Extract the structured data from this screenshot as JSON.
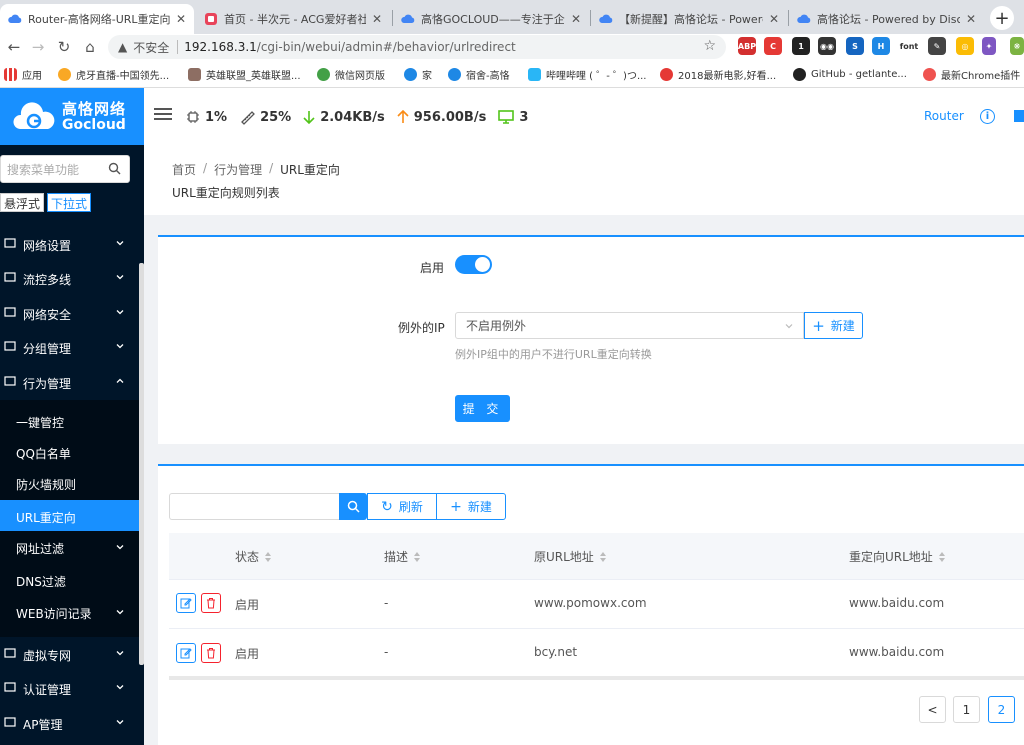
{
  "browser": {
    "tabs": [
      {
        "label": "Router-高恪网络-URL重定向",
        "icon_color": "#4285f4",
        "active": true
      },
      {
        "label": "首页 - 半次元 - ACG爱好者社区",
        "icon_color": "#e8445a",
        "active": false
      },
      {
        "label": "高恪GOCLOUD——专注于企业",
        "icon_color": "#4285f4",
        "active": false
      },
      {
        "label": "【新提醒】高恪论坛 - Powere",
        "icon_color": "#4285f4",
        "active": false
      },
      {
        "label": "高恪论坛 - Powered by Discu",
        "icon_color": "#4285f4",
        "active": false
      }
    ],
    "address": {
      "insecure_label": "不安全",
      "host": "192.168.3.1",
      "path": "/cgi-bin/webui/admin#/behavior/urlredirect"
    },
    "extensions": [
      {
        "name": "abp-icon",
        "label": "ABP",
        "color": "#d32f2f"
      },
      {
        "name": "extension-red-icon",
        "label": "C",
        "color": "#e53935"
      },
      {
        "name": "extension-badge-icon",
        "label": "1",
        "color": "#222222"
      },
      {
        "name": "extension-mask-icon",
        "label": "◉◉",
        "color": "#333333"
      },
      {
        "name": "extension-s-icon",
        "label": "S",
        "color": "#1565c0"
      },
      {
        "name": "extension-h-icon",
        "label": "H",
        "color": "#1e88e5"
      },
      {
        "name": "extension-font-icon",
        "label": "font",
        "color": "#ffffff"
      },
      {
        "name": "extension-gesture-icon",
        "label": "✎",
        "color": "#444444"
      },
      {
        "name": "chrome-icon",
        "label": "◎",
        "color": "#fbbc05"
      },
      {
        "name": "extension-purple-icon",
        "label": "✦",
        "color": "#7e57c2"
      },
      {
        "name": "extension-frog-icon",
        "label": "❋",
        "color": "#7cb342"
      }
    ],
    "bookmarks": [
      {
        "label": "应用",
        "color": "#e53935"
      },
      {
        "label": "虎牙直播-中国领先...",
        "color": "#f9a825"
      },
      {
        "label": "英雄联盟_英雄联盟...",
        "color": "#8d6e63"
      },
      {
        "label": "微信网页版",
        "color": "#43a047"
      },
      {
        "label": "家",
        "color": "#1e88e5"
      },
      {
        "label": "宿舍-高恪",
        "color": "#1e88e5"
      },
      {
        "label": "哔哩哔哩 ( ゜- ゜)つ...",
        "color": "#29b6f6"
      },
      {
        "label": "2018最新电影,好看...",
        "color": "#e53935"
      },
      {
        "label": "GitHub - getlante...",
        "color": "#212121"
      },
      {
        "label": "最新Chrome插件",
        "color": "#ef5350"
      }
    ]
  },
  "header": {
    "logo_cn": "高恪网络",
    "logo_en": "Gocloud",
    "cpu": "1%",
    "memory": "25%",
    "download": "2.04KB/s",
    "upload": "956.00B/s",
    "devices": "3",
    "router_label": "Router",
    "colors": {
      "download": "#52c41a",
      "upload": "#fa8c16",
      "devices": "#52c41a"
    }
  },
  "sidebar": {
    "search_placeholder": "搜索菜单功能",
    "mode_float": "悬浮式",
    "mode_dropdown": "下拉式",
    "menu": [
      {
        "label": "网络设置",
        "icon": "monitor-icon"
      },
      {
        "label": "流控多线",
        "icon": "flow-icon"
      },
      {
        "label": "网络安全",
        "icon": "shield-icon"
      },
      {
        "label": "分组管理",
        "icon": "group-icon"
      },
      {
        "label": "行为管理",
        "icon": "funnel-icon",
        "expanded": true
      }
    ],
    "submenu": [
      {
        "label": "一键管控"
      },
      {
        "label": "QQ白名单"
      },
      {
        "label": "防火墙规则"
      },
      {
        "label": "URL重定向",
        "active": true
      },
      {
        "label": "网址过滤",
        "has_children": true
      },
      {
        "label": "DNS过滤"
      },
      {
        "label": "WEB访问记录",
        "has_children": true
      }
    ],
    "menu_after": [
      {
        "label": "虚拟专网",
        "icon": "vpn-icon"
      },
      {
        "label": "认证管理",
        "icon": "auth-shield-icon"
      },
      {
        "label": "AP管理",
        "icon": "ap-icon"
      }
    ]
  },
  "breadcrumb": [
    "首页",
    "行为管理",
    "URL重定向"
  ],
  "page_title": "URL重定向规则列表",
  "form": {
    "enable_label": "启用",
    "enabled": true,
    "exception_ip_label": "例外的IP",
    "exception_ip_value": "不启用例外",
    "new_label": "新建",
    "hint": "例外IP组中的用户不进行URL重定向转换",
    "submit_label": "提 交"
  },
  "toolbar": {
    "search_value": "",
    "refresh_label": "刷新",
    "new_label": "新建"
  },
  "table": {
    "columns": [
      "状态",
      "描述",
      "原URL地址",
      "重定向URL地址"
    ],
    "rows": [
      {
        "status": "启用",
        "desc": "-",
        "source": "www.pomowx.com",
        "target": "www.baidu.com"
      },
      {
        "status": "启用",
        "desc": "-",
        "source": "bcy.net",
        "target": "www.baidu.com"
      }
    ]
  },
  "pagination": {
    "prev": "<",
    "pages": [
      "1",
      "2"
    ],
    "current": "2"
  },
  "colors": {
    "primary": "#1890ff",
    "danger": "#f5222d",
    "sidebar_bg": "#001529"
  }
}
